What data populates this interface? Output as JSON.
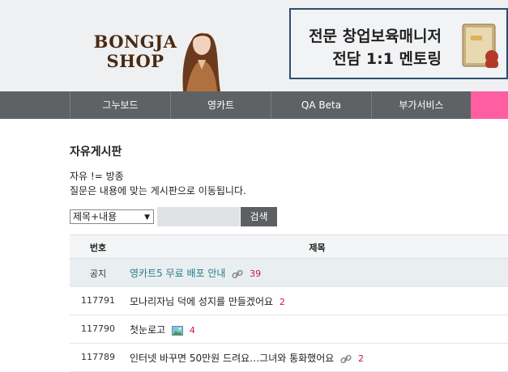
{
  "header": {
    "logo_line1": "BONGJA",
    "logo_line2": "SHOP",
    "banner_line1": "전문 창업보육매니저",
    "banner_line2": "전담 1:1 멘토링"
  },
  "nav": {
    "items": [
      {
        "label": "그누보드"
      },
      {
        "label": "영카트"
      },
      {
        "label": "QA Beta"
      },
      {
        "label": "부가서비스"
      }
    ]
  },
  "board": {
    "title": "자유게시판",
    "desc_line1": "자유 != 방종",
    "desc_line2": "질문은 내용에 맞는 게시판으로 이동됩니다."
  },
  "search": {
    "select_value": "제목+내용",
    "input_value": "",
    "button_label": "검색"
  },
  "table": {
    "col_num": "번호",
    "col_title": "제목",
    "rows": [
      {
        "num": "공지",
        "title": "영카트5 무료 배포 안내",
        "count": "39",
        "notice": true,
        "icon": "link-icon"
      },
      {
        "num": "117791",
        "title": "모나리자님 덕에 성지를 만들겠어요",
        "count": "2",
        "notice": false,
        "icon": ""
      },
      {
        "num": "117790",
        "title": "첫눈로고",
        "count": "4",
        "notice": false,
        "icon": "image-icon"
      },
      {
        "num": "117789",
        "title": "인터넷 바꾸면 50만원 드려요…그녀와 통화했어요",
        "count": "2",
        "notice": false,
        "icon": "link-icon"
      }
    ]
  },
  "colors": {
    "nav_bg": "#5f6264",
    "nav_accent": "#ff5ea3",
    "count": "#d0106a",
    "notice_link": "#2a7a8c"
  }
}
